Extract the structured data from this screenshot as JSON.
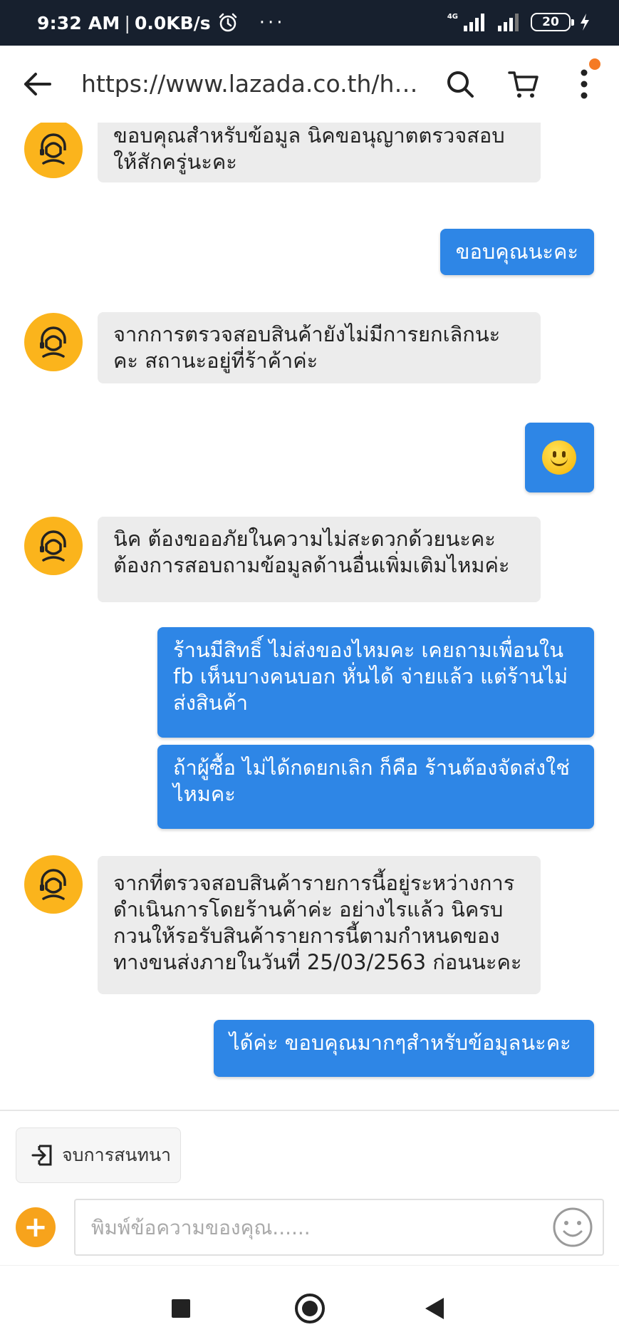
{
  "status_bar": {
    "time": "9:32 AM",
    "separator": "|",
    "speed": "0.0KB/s",
    "more": "···",
    "network": "4G",
    "battery": "20"
  },
  "browser": {
    "url": "https://www.lazada.co.th/hel..."
  },
  "messages": [
    {
      "sender": "agent",
      "text": "ขอบคุณสำหรับข้อมูล นิคขอนุญาตตรวจสอบให้สักครู่นะคะ"
    },
    {
      "sender": "user",
      "text": "ขอบคุณนะคะ"
    },
    {
      "sender": "agent",
      "text": "จากการตรวจสอบสินค้ายังไม่มีการยกเลิกนะคะ สถานะอยู่ที่ร้าค้าค่ะ"
    },
    {
      "sender": "user",
      "text": ""
    },
    {
      "sender": "agent",
      "text": "นิค ต้องขออภัยในความไม่สะดวกด้วยนะคะ ต้องการสอบถามข้อมูลด้านอื่นเพิ่มเติมไหมค่ะ"
    },
    {
      "sender": "user",
      "text": "ร้านมีสิทธิ์ ไม่ส่งของไหมคะ เคยถามเพื่อนใน fb เห็นบางคนบอก หั่นได้ จ่ายแล้ว แต่ร้านไม่ส่งสินค้า"
    },
    {
      "sender": "user",
      "text": "ถ้าผู้ซื้อ ไม่ได้กดยกเลิก ก็คือ ร้านต้องจัดส่งใช่ไหมคะ"
    },
    {
      "sender": "agent",
      "text": "จากที่ตรวจสอบสินค้ารายการนี้อยู่ระหว่างการดำเนินการโดยร้านค้าค่ะ อย่างไรแล้ว นิครบกวนให้รอรับสินค้ารายการนี้ตามกำหนดของทางขนส่งภายในวันที่ 25/03/2563 ก่อนนะคะ"
    },
    {
      "sender": "user",
      "text": "ได้ค่ะ ขอบคุณมากๆสำหรับข้อมูลนะคะ"
    }
  ],
  "composer": {
    "end_chat_label": "จบการสนทนา",
    "add_label": "+",
    "placeholder": "พิมพ์ข้อความของคุณ......"
  },
  "colors": {
    "status_bar": "#17202e",
    "user_bubble": "#2e86e6",
    "agent_bubble": "#ececec",
    "avatar": "#fbb41c",
    "accent": "#f7a31c"
  }
}
